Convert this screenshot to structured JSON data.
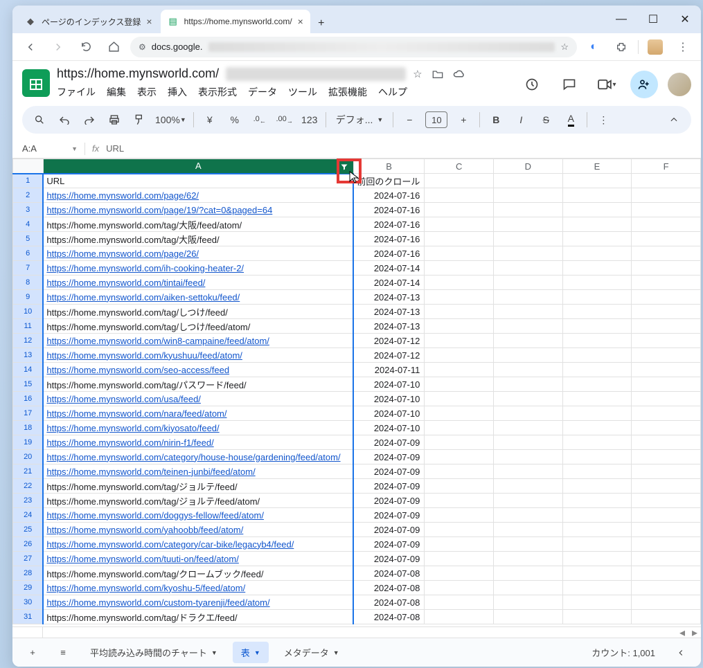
{
  "browser": {
    "tabs": [
      {
        "favicon": "⬚",
        "title": "ページのインデックス登録"
      },
      {
        "favicon": "▦",
        "title": "https://home.mynsworld.com/"
      }
    ],
    "url_display": "docs.google.",
    "window_controls": {
      "min": "—",
      "max": "☐",
      "close": "✕"
    }
  },
  "doc": {
    "title": "https://home.mynsworld.com/",
    "menus": [
      "ファイル",
      "編集",
      "表示",
      "挿入",
      "表示形式",
      "データ",
      "ツール",
      "拡張機能",
      "ヘルプ"
    ]
  },
  "toolbar": {
    "zoom": "100%",
    "currency": "¥",
    "percent": "%",
    "dec_dec": ".0",
    "dec_inc": ".00",
    "fmt": "123",
    "font": "デフォ...",
    "fontsize": "10"
  },
  "namebox": {
    "ref": "A:A",
    "formula": "URL"
  },
  "columns": [
    "A",
    "B",
    "C",
    "D",
    "E",
    "F"
  ],
  "header_row": {
    "A": "URL",
    "B": "前回のクロール"
  },
  "rows": [
    {
      "n": 1,
      "A": "URL",
      "B": "前回のクロール",
      "link": false,
      "header": true
    },
    {
      "n": 2,
      "A": "https://home.mynsworld.com/page/62/",
      "B": "2024-07-16",
      "link": true
    },
    {
      "n": 3,
      "A": "https://home.mynsworld.com/page/19/?cat=0&paged=64",
      "B": "2024-07-16",
      "link": true
    },
    {
      "n": 4,
      "A": "https://home.mynsworld.com/tag/大阪/feed/atom/",
      "B": "2024-07-16",
      "link": false
    },
    {
      "n": 5,
      "A": "https://home.mynsworld.com/tag/大阪/feed/",
      "B": "2024-07-16",
      "link": false
    },
    {
      "n": 6,
      "A": "https://home.mynsworld.com/page/26/",
      "B": "2024-07-16",
      "link": true
    },
    {
      "n": 7,
      "A": "https://home.mynsworld.com/ih-cooking-heater-2/",
      "B": "2024-07-14",
      "link": true
    },
    {
      "n": 8,
      "A": "https://home.mynsworld.com/tintai/feed/",
      "B": "2024-07-14",
      "link": true
    },
    {
      "n": 9,
      "A": "https://home.mynsworld.com/aiken-settoku/feed/",
      "B": "2024-07-13",
      "link": true
    },
    {
      "n": 10,
      "A": "https://home.mynsworld.com/tag/しつけ/feed/",
      "B": "2024-07-13",
      "link": false
    },
    {
      "n": 11,
      "A": "https://home.mynsworld.com/tag/しつけ/feed/atom/",
      "B": "2024-07-13",
      "link": false
    },
    {
      "n": 12,
      "A": "https://home.mynsworld.com/win8-campaine/feed/atom/",
      "B": "2024-07-12",
      "link": true
    },
    {
      "n": 13,
      "A": "https://home.mynsworld.com/kyushuu/feed/atom/",
      "B": "2024-07-12",
      "link": true
    },
    {
      "n": 14,
      "A": "https://home.mynsworld.com/seo-access/feed",
      "B": "2024-07-11",
      "link": true
    },
    {
      "n": 15,
      "A": "https://home.mynsworld.com/tag/パスワード/feed/",
      "B": "2024-07-10",
      "link": false
    },
    {
      "n": 16,
      "A": "https://home.mynsworld.com/usa/feed/",
      "B": "2024-07-10",
      "link": true
    },
    {
      "n": 17,
      "A": "https://home.mynsworld.com/nara/feed/atom/",
      "B": "2024-07-10",
      "link": true
    },
    {
      "n": 18,
      "A": "https://home.mynsworld.com/kiyosato/feed/",
      "B": "2024-07-10",
      "link": true
    },
    {
      "n": 19,
      "A": "https://home.mynsworld.com/nirin-f1/feed/",
      "B": "2024-07-09",
      "link": true
    },
    {
      "n": 20,
      "A": "https://home.mynsworld.com/category/house-house/gardening/feed/atom/",
      "B": "2024-07-09",
      "link": true
    },
    {
      "n": 21,
      "A": "https://home.mynsworld.com/teinen-junbi/feed/atom/",
      "B": "2024-07-09",
      "link": true
    },
    {
      "n": 22,
      "A": "https://home.mynsworld.com/tag/ジョルテ/feed/",
      "B": "2024-07-09",
      "link": false
    },
    {
      "n": 23,
      "A": "https://home.mynsworld.com/tag/ジョルテ/feed/atom/",
      "B": "2024-07-09",
      "link": false
    },
    {
      "n": 24,
      "A": "https://home.mynsworld.com/doggys-fellow/feed/atom/",
      "B": "2024-07-09",
      "link": true
    },
    {
      "n": 25,
      "A": "https://home.mynsworld.com/yahoobb/feed/atom/",
      "B": "2024-07-09",
      "link": true
    },
    {
      "n": 26,
      "A": "https://home.mynsworld.com/category/car-bike/legacyb4/feed/",
      "B": "2024-07-09",
      "link": true
    },
    {
      "n": 27,
      "A": "https://home.mynsworld.com/tuuti-on/feed/atom/",
      "B": "2024-07-09",
      "link": true
    },
    {
      "n": 28,
      "A": "https://home.mynsworld.com/tag/クロームブック/feed/",
      "B": "2024-07-08",
      "link": false
    },
    {
      "n": 29,
      "A": "https://home.mynsworld.com/kyoshu-5/feed/atom/",
      "B": "2024-07-08",
      "link": true
    },
    {
      "n": 30,
      "A": "https://home.mynsworld.com/custom-tyarenji/feed/atom/",
      "B": "2024-07-08",
      "link": true
    },
    {
      "n": 31,
      "A": "https://home.mynsworld.com/tag/ドラクエ/feed/",
      "B": "2024-07-08",
      "link": false
    }
  ],
  "sheet_tabs": [
    {
      "label": "平均読み込み時間のチャート",
      "active": false
    },
    {
      "label": "表",
      "active": true
    },
    {
      "label": "メタデータ",
      "active": false
    }
  ],
  "status": {
    "count_label": "カウント: 1,001"
  }
}
